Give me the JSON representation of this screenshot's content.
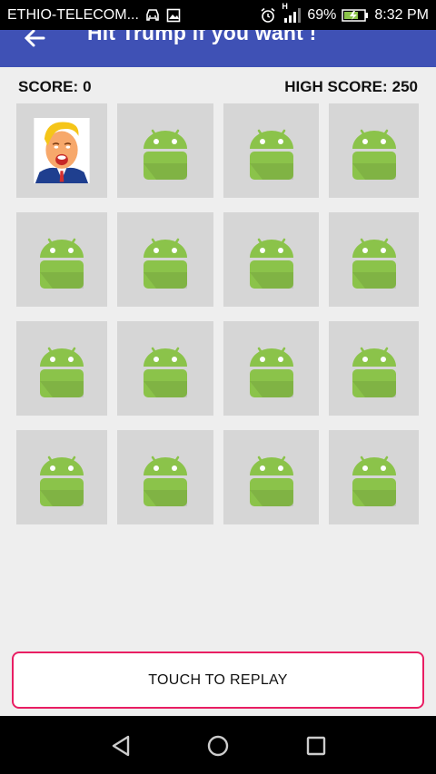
{
  "status_bar": {
    "carrier": "ETHIO-TELECOM...",
    "battery_percent": "69%",
    "time": "8:32 PM",
    "network": "H"
  },
  "app_bar": {
    "title": "Hit Trump if you want !"
  },
  "scores": {
    "score_label": "SCORE:",
    "score_value": "0",
    "high_score_label": "HIGH SCORE:",
    "high_score_value": "250"
  },
  "grid": {
    "cells": [
      {
        "type": "trump"
      },
      {
        "type": "android"
      },
      {
        "type": "android"
      },
      {
        "type": "android"
      },
      {
        "type": "android"
      },
      {
        "type": "android"
      },
      {
        "type": "android"
      },
      {
        "type": "android"
      },
      {
        "type": "android"
      },
      {
        "type": "android"
      },
      {
        "type": "android"
      },
      {
        "type": "android"
      },
      {
        "type": "android"
      },
      {
        "type": "android"
      },
      {
        "type": "android"
      },
      {
        "type": "android"
      }
    ],
    "android_color": "#8bc34a",
    "cell_bg": "#d6d6d6"
  },
  "replay": {
    "label": "TOUCH TO REPLAY",
    "border_color": "#e91e63"
  },
  "colors": {
    "app_bar": "#3f51b5",
    "background": "#eeeeee"
  },
  "icons": {
    "back": "back-arrow-icon",
    "nav_back": "triangle-back-icon",
    "nav_home": "circle-home-icon",
    "nav_recents": "square-recents-icon"
  }
}
